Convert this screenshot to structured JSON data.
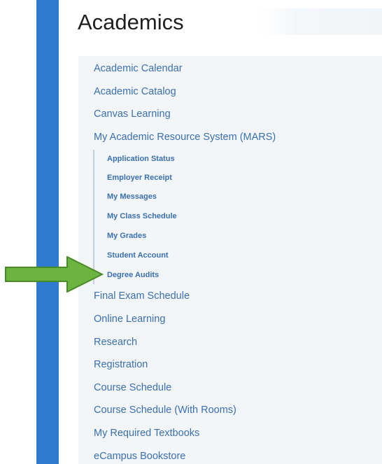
{
  "page": {
    "title": "Academics"
  },
  "menu": {
    "items": [
      {
        "label": "Academic Calendar"
      },
      {
        "label": "Academic Catalog"
      },
      {
        "label": "Canvas Learning"
      },
      {
        "label": "My Academic Resource System (MARS)"
      },
      {
        "label": "Final Exam Schedule"
      },
      {
        "label": "Online Learning"
      },
      {
        "label": "Research"
      },
      {
        "label": "Registration"
      },
      {
        "label": "Course Schedule"
      },
      {
        "label": "Course Schedule (With Rooms)"
      },
      {
        "label": "My Required Textbooks"
      },
      {
        "label": "eCampus Bookstore"
      }
    ],
    "mars_subitems": [
      {
        "label": "Application Status"
      },
      {
        "label": "Employer Receipt"
      },
      {
        "label": "My Messages"
      },
      {
        "label": "My Class Schedule"
      },
      {
        "label": "My Grades"
      },
      {
        "label": "Student Account"
      },
      {
        "label": "Degree Audits"
      }
    ]
  },
  "annotation": {
    "icon": "arrow-right-icon",
    "color": "#6db33f",
    "points_to": "Degree Audits"
  },
  "colors": {
    "sidebar": "#2f7bd0",
    "link": "#3a6fb0",
    "panel": "#f3f6f9"
  }
}
